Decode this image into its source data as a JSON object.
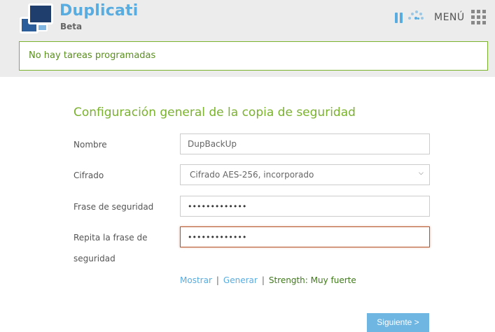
{
  "header": {
    "app_name": "Duplicati",
    "edition": "Beta",
    "menu_label": "MENÚ"
  },
  "status": {
    "message": "No hay tareas programadas"
  },
  "form": {
    "title": "Configuración general de la copia de seguridad",
    "name_label": "Nombre",
    "name_value": "DupBackUp",
    "encryption_label": "Cifrado",
    "encryption_value": "Cifrado AES-256, incorporado",
    "passphrase_label": "Frase de seguridad",
    "passphrase_value": "•••••••••••••",
    "repeat_label": "Repita la frase de seguridad",
    "repeat_value": "•••••••••••••",
    "show_link": "Mostrar",
    "separator": "|",
    "generate_link": "Generar",
    "strength_text": "Strength: Muy fuerte",
    "next_button": "Siguiente >"
  },
  "icons": {
    "pause": "pause-icon",
    "throttle": "throttle-icon",
    "grid": "grid-icon",
    "chevron": "chevron-down-icon"
  },
  "colors": {
    "brand_blue": "#58ace0",
    "accent_green": "#7ab22e",
    "error_border": "#b6552b",
    "button_blue": "#6fb6e3"
  }
}
